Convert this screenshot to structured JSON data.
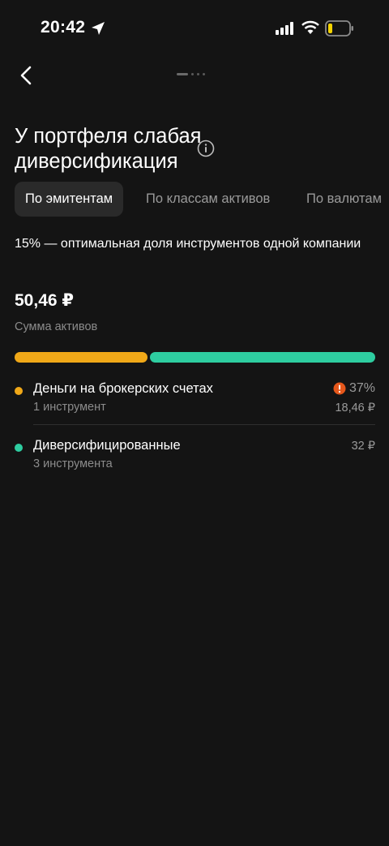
{
  "status_bar": {
    "time": "20:42"
  },
  "nav": {
    "pager_active_index": 0
  },
  "title": "У портфеля слабая диверсификация",
  "tabs": [
    {
      "label": "По эмитентам",
      "active": true
    },
    {
      "label": "По классам активов",
      "active": false
    },
    {
      "label": "По валютам",
      "active": false
    }
  ],
  "description": "15% — оптимальная доля инструментов одной компании",
  "summary": {
    "total": "50,46 ₽",
    "total_label": "Сумма активов"
  },
  "distribution_bar": [
    {
      "share": 0.37,
      "color": "#F0A818"
    },
    {
      "share": 0.63,
      "color": "#2ECDA0"
    }
  ],
  "items": [
    {
      "name": "Деньги на брокерских счетах",
      "sub": "1 инструмент",
      "percent": "37%",
      "amount": "18,46 ₽",
      "color": "#F0A818",
      "warning": true,
      "icon": "warning-icon"
    },
    {
      "name": "Диверсифицированные",
      "sub": "3 инструмента",
      "amount": "32 ₽",
      "color": "#2ECDA0",
      "warning": false
    }
  ],
  "colors": {
    "background": "#141414",
    "warning": "#E5571B",
    "muted_text": "#8C8C8C"
  }
}
